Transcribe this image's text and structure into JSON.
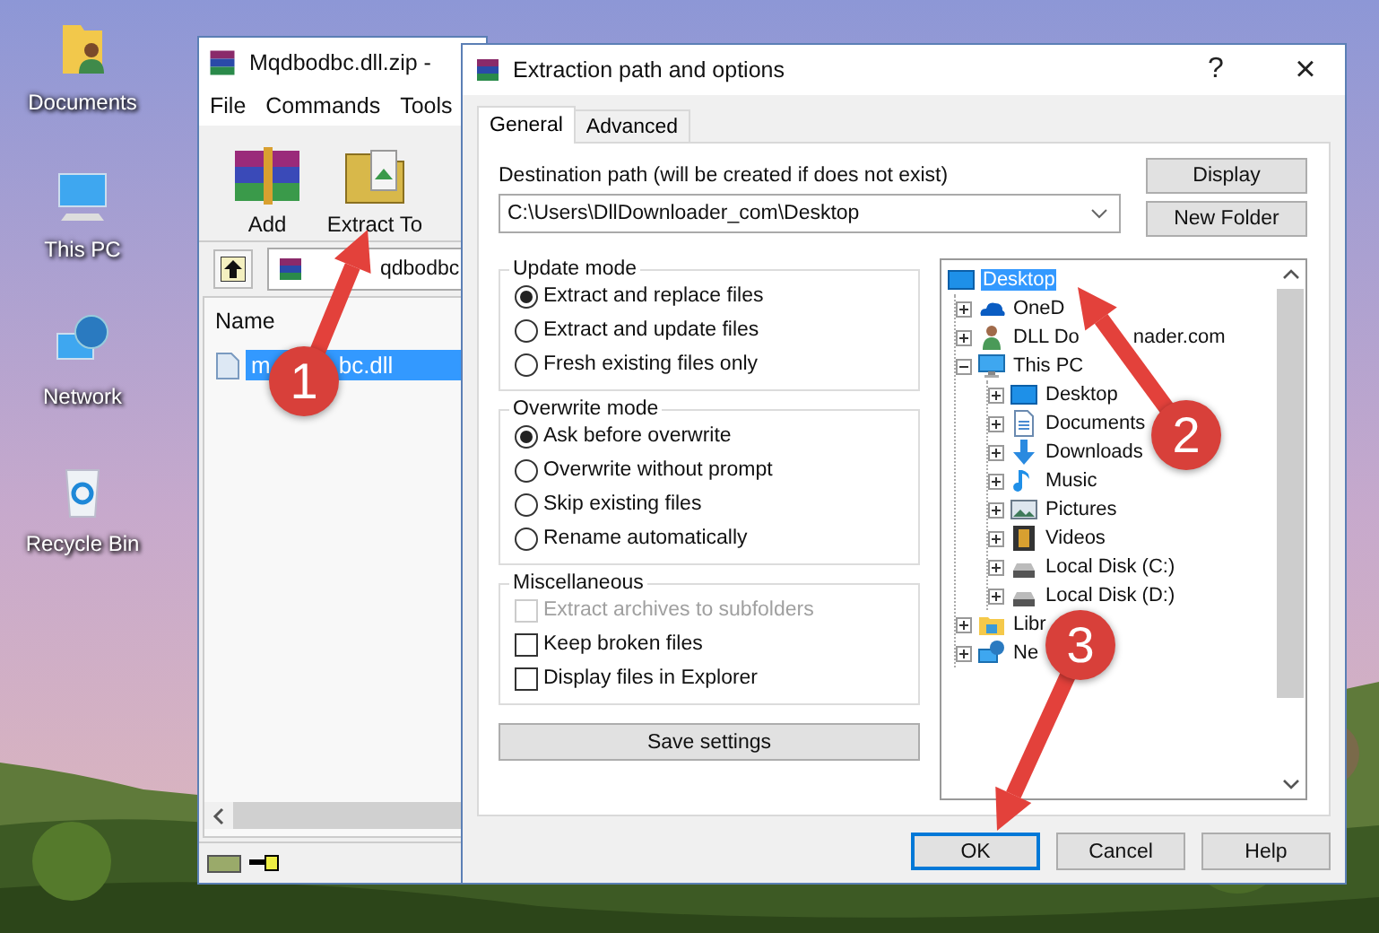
{
  "desktop_icons": [
    {
      "label": "Documents",
      "kind": "documents"
    },
    {
      "label": "This PC",
      "kind": "pc"
    },
    {
      "label": "Network",
      "kind": "network"
    },
    {
      "label": "Recycle Bin",
      "kind": "recycle"
    }
  ],
  "archiver_window": {
    "title": "Mqdbodbc.dll.zip -",
    "menu": [
      "File",
      "Commands",
      "Tools"
    ],
    "toolbar": [
      {
        "label": "Add",
        "kind": "add"
      },
      {
        "label": "Extract To",
        "kind": "extract"
      }
    ],
    "path": "qdbodbc",
    "columns": [
      "Name"
    ],
    "files": [
      {
        "name": "m",
        "name_tail": "bc.dll",
        "selected": true
      }
    ]
  },
  "dialog": {
    "title": "Extraction path and options",
    "help": "?",
    "close": "×",
    "tabs": [
      {
        "label": "General",
        "selected": true
      },
      {
        "label": "Advanced",
        "selected": false
      }
    ],
    "destination_label": "Destination path (will be created if does not exist)",
    "destination_value": "C:\\Users\\DllDownloader_com\\Desktop",
    "side_buttons": [
      "Display",
      "New Folder"
    ],
    "groups": [
      {
        "title": "Update mode",
        "options": [
          {
            "label": "Extract and replace files",
            "kind": "radio",
            "selected": true
          },
          {
            "label": "Extract and update files",
            "kind": "radio",
            "selected": false
          },
          {
            "label": "Fresh existing files only",
            "kind": "radio",
            "selected": false
          }
        ]
      },
      {
        "title": "Overwrite mode",
        "options": [
          {
            "label": "Ask before overwrite",
            "kind": "radio",
            "selected": true
          },
          {
            "label": "Overwrite without prompt",
            "kind": "radio",
            "selected": false
          },
          {
            "label": "Skip existing files",
            "kind": "radio",
            "selected": false
          },
          {
            "label": "Rename automatically",
            "kind": "radio",
            "selected": false
          }
        ]
      },
      {
        "title": "Miscellaneous",
        "options": [
          {
            "label": "Extract archives to subfolders",
            "kind": "checkbox",
            "checked": false,
            "disabled": true
          },
          {
            "label": "Keep broken files",
            "kind": "checkbox",
            "checked": false,
            "disabled": false
          },
          {
            "label": "Display files in Explorer",
            "kind": "checkbox",
            "checked": false,
            "disabled": false
          }
        ]
      }
    ],
    "save_button": "Save settings",
    "tree": {
      "label": "Desktop",
      "kind": "desktop",
      "selected": true,
      "children": [
        {
          "label": "OneD",
          "kind": "onedrive",
          "selected": false,
          "expanded": false
        },
        {
          "label": "DLL Do",
          "label_tail": "nader.com",
          "kind": "user",
          "selected": false,
          "expanded": false
        },
        {
          "label": "This PC",
          "kind": "pc",
          "selected": false,
          "expanded": true,
          "children": [
            {
              "label": "Desktop",
              "kind": "desktop",
              "selected": false,
              "expanded": false
            },
            {
              "label": "Documents",
              "kind": "documents",
              "selected": false,
              "expanded": false
            },
            {
              "label": "Downloads",
              "kind": "downloads",
              "selected": false,
              "expanded": false
            },
            {
              "label": "Music",
              "kind": "music",
              "selected": false,
              "expanded": false
            },
            {
              "label": "Pictures",
              "kind": "pictures",
              "selected": false,
              "expanded": false
            },
            {
              "label": "Videos",
              "kind": "videos",
              "selected": false,
              "expanded": false
            },
            {
              "label": "Local Disk (C:)",
              "kind": "disk",
              "selected": false,
              "expanded": false
            },
            {
              "label": "Local Disk (D:)",
              "kind": "disk",
              "selected": false,
              "expanded": false
            }
          ]
        },
        {
          "label": "Libr",
          "kind": "libraries",
          "selected": false,
          "expanded": false
        },
        {
          "label": "Ne",
          "kind": "network",
          "selected": false,
          "expanded": false
        }
      ]
    },
    "buttons": [
      {
        "label": "OK",
        "default": true
      },
      {
        "label": "Cancel",
        "default": false
      },
      {
        "label": "Help",
        "default": false
      }
    ]
  },
  "annotations": [
    {
      "label": "1"
    },
    {
      "label": "2"
    },
    {
      "label": "3"
    }
  ]
}
